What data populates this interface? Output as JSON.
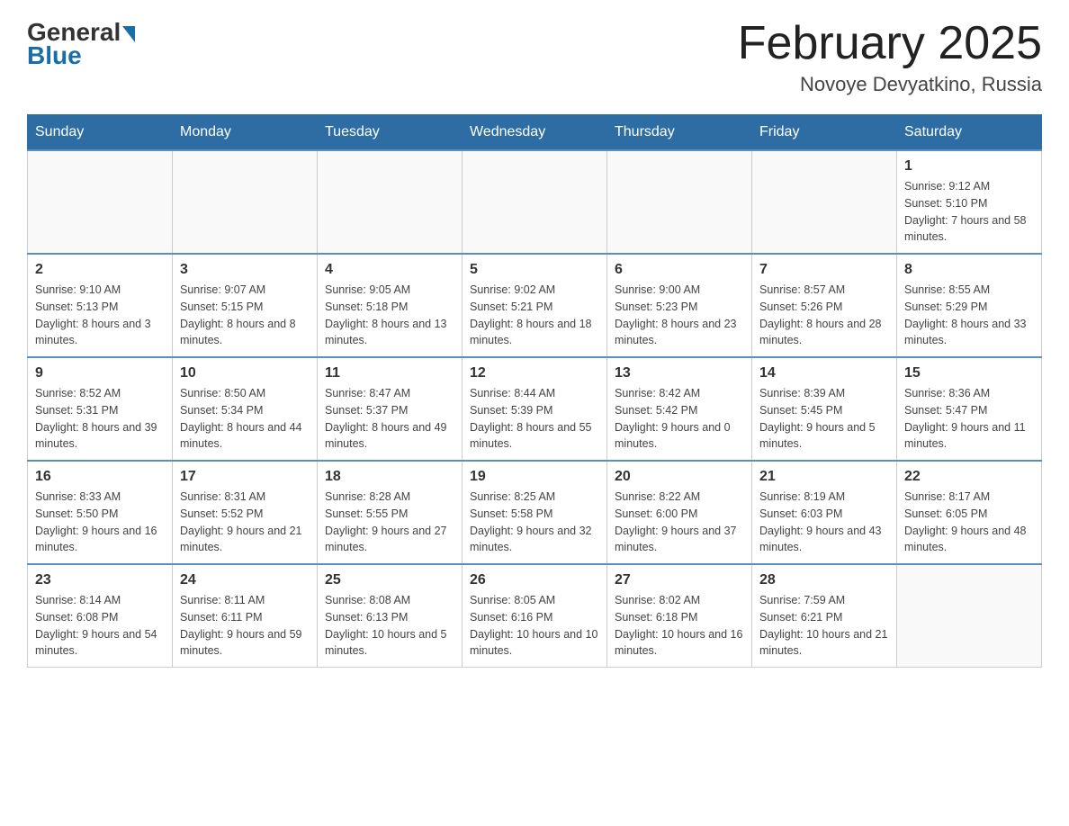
{
  "header": {
    "logo_general": "General",
    "logo_blue": "Blue",
    "title": "February 2025",
    "subtitle": "Novoye Devyatkino, Russia"
  },
  "days_of_week": [
    "Sunday",
    "Monday",
    "Tuesday",
    "Wednesday",
    "Thursday",
    "Friday",
    "Saturday"
  ],
  "weeks": [
    [
      {
        "day": "",
        "info": ""
      },
      {
        "day": "",
        "info": ""
      },
      {
        "day": "",
        "info": ""
      },
      {
        "day": "",
        "info": ""
      },
      {
        "day": "",
        "info": ""
      },
      {
        "day": "",
        "info": ""
      },
      {
        "day": "1",
        "info": "Sunrise: 9:12 AM\nSunset: 5:10 PM\nDaylight: 7 hours and 58 minutes."
      }
    ],
    [
      {
        "day": "2",
        "info": "Sunrise: 9:10 AM\nSunset: 5:13 PM\nDaylight: 8 hours and 3 minutes."
      },
      {
        "day": "3",
        "info": "Sunrise: 9:07 AM\nSunset: 5:15 PM\nDaylight: 8 hours and 8 minutes."
      },
      {
        "day": "4",
        "info": "Sunrise: 9:05 AM\nSunset: 5:18 PM\nDaylight: 8 hours and 13 minutes."
      },
      {
        "day": "5",
        "info": "Sunrise: 9:02 AM\nSunset: 5:21 PM\nDaylight: 8 hours and 18 minutes."
      },
      {
        "day": "6",
        "info": "Sunrise: 9:00 AM\nSunset: 5:23 PM\nDaylight: 8 hours and 23 minutes."
      },
      {
        "day": "7",
        "info": "Sunrise: 8:57 AM\nSunset: 5:26 PM\nDaylight: 8 hours and 28 minutes."
      },
      {
        "day": "8",
        "info": "Sunrise: 8:55 AM\nSunset: 5:29 PM\nDaylight: 8 hours and 33 minutes."
      }
    ],
    [
      {
        "day": "9",
        "info": "Sunrise: 8:52 AM\nSunset: 5:31 PM\nDaylight: 8 hours and 39 minutes."
      },
      {
        "day": "10",
        "info": "Sunrise: 8:50 AM\nSunset: 5:34 PM\nDaylight: 8 hours and 44 minutes."
      },
      {
        "day": "11",
        "info": "Sunrise: 8:47 AM\nSunset: 5:37 PM\nDaylight: 8 hours and 49 minutes."
      },
      {
        "day": "12",
        "info": "Sunrise: 8:44 AM\nSunset: 5:39 PM\nDaylight: 8 hours and 55 minutes."
      },
      {
        "day": "13",
        "info": "Sunrise: 8:42 AM\nSunset: 5:42 PM\nDaylight: 9 hours and 0 minutes."
      },
      {
        "day": "14",
        "info": "Sunrise: 8:39 AM\nSunset: 5:45 PM\nDaylight: 9 hours and 5 minutes."
      },
      {
        "day": "15",
        "info": "Sunrise: 8:36 AM\nSunset: 5:47 PM\nDaylight: 9 hours and 11 minutes."
      }
    ],
    [
      {
        "day": "16",
        "info": "Sunrise: 8:33 AM\nSunset: 5:50 PM\nDaylight: 9 hours and 16 minutes."
      },
      {
        "day": "17",
        "info": "Sunrise: 8:31 AM\nSunset: 5:52 PM\nDaylight: 9 hours and 21 minutes."
      },
      {
        "day": "18",
        "info": "Sunrise: 8:28 AM\nSunset: 5:55 PM\nDaylight: 9 hours and 27 minutes."
      },
      {
        "day": "19",
        "info": "Sunrise: 8:25 AM\nSunset: 5:58 PM\nDaylight: 9 hours and 32 minutes."
      },
      {
        "day": "20",
        "info": "Sunrise: 8:22 AM\nSunset: 6:00 PM\nDaylight: 9 hours and 37 minutes."
      },
      {
        "day": "21",
        "info": "Sunrise: 8:19 AM\nSunset: 6:03 PM\nDaylight: 9 hours and 43 minutes."
      },
      {
        "day": "22",
        "info": "Sunrise: 8:17 AM\nSunset: 6:05 PM\nDaylight: 9 hours and 48 minutes."
      }
    ],
    [
      {
        "day": "23",
        "info": "Sunrise: 8:14 AM\nSunset: 6:08 PM\nDaylight: 9 hours and 54 minutes."
      },
      {
        "day": "24",
        "info": "Sunrise: 8:11 AM\nSunset: 6:11 PM\nDaylight: 9 hours and 59 minutes."
      },
      {
        "day": "25",
        "info": "Sunrise: 8:08 AM\nSunset: 6:13 PM\nDaylight: 10 hours and 5 minutes."
      },
      {
        "day": "26",
        "info": "Sunrise: 8:05 AM\nSunset: 6:16 PM\nDaylight: 10 hours and 10 minutes."
      },
      {
        "day": "27",
        "info": "Sunrise: 8:02 AM\nSunset: 6:18 PM\nDaylight: 10 hours and 16 minutes."
      },
      {
        "day": "28",
        "info": "Sunrise: 7:59 AM\nSunset: 6:21 PM\nDaylight: 10 hours and 21 minutes."
      },
      {
        "day": "",
        "info": ""
      }
    ]
  ]
}
